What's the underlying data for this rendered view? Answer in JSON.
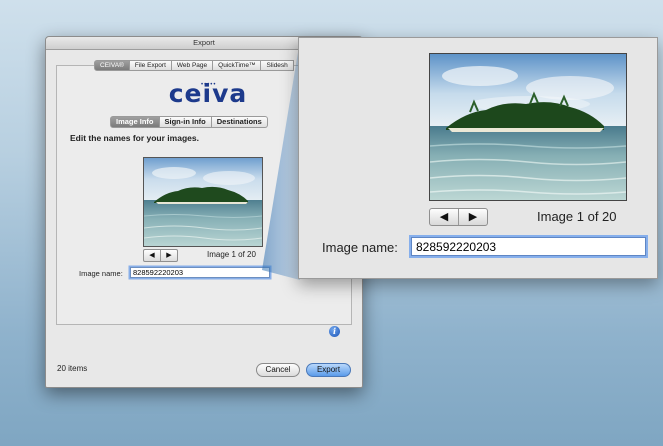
{
  "window": {
    "title": "Export",
    "tabs": [
      {
        "label": "CEIVA®",
        "selected": true
      },
      {
        "label": "File Export",
        "selected": false
      },
      {
        "label": "Web Page",
        "selected": false
      },
      {
        "label": "QuickTime™",
        "selected": false
      },
      {
        "label": "Slidesh",
        "selected": false
      }
    ],
    "logo_text": "ceiva",
    "logo_dots": "•••••",
    "subtabs": [
      {
        "label": "Image Info",
        "selected": true
      },
      {
        "label": "Sign-in Info",
        "selected": false
      },
      {
        "label": "Destinations",
        "selected": false
      }
    ],
    "instruction": "Edit the names for your images.",
    "counter": "Image 1 of 20",
    "image_name_label": "Image name:",
    "image_name_value": "828592220203",
    "item_count": "20 items",
    "cancel_label": "Cancel",
    "export_label": "Export",
    "info_icon_glyph": "i"
  },
  "zoom": {
    "counter": "Image 1 of 20",
    "image_name_label": "Image name:",
    "image_name_value": "828592220203"
  },
  "stepper": {
    "prev_glyph": "◀",
    "next_glyph": "▶"
  },
  "colors": {
    "accent": "#1d3a8c",
    "focus_ring": "#86afec",
    "export_button": "#5a9bea"
  }
}
